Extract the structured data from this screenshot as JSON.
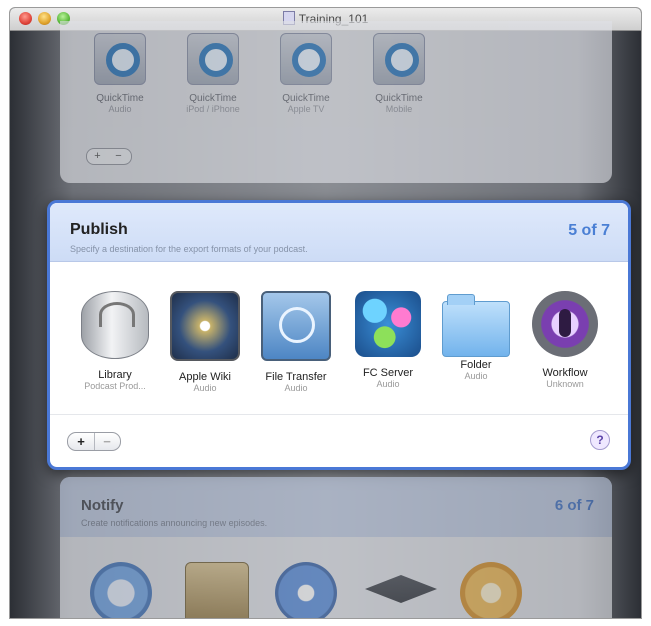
{
  "window": {
    "title": "Training_101"
  },
  "top_card": {
    "items": [
      {
        "label": "QuickTime",
        "sub": "Audio"
      },
      {
        "label": "QuickTime",
        "sub": "iPod / iPhone"
      },
      {
        "label": "QuickTime",
        "sub": "Apple TV"
      },
      {
        "label": "QuickTime",
        "sub": "Mobile"
      }
    ],
    "add": "+",
    "remove": "−"
  },
  "publish": {
    "title": "Publish",
    "subtitle": "Specify a destination for the export formats of your podcast.",
    "count": "5 of 7",
    "targets": [
      {
        "label": "Library",
        "sub": "Podcast Prod..."
      },
      {
        "label": "Apple Wiki",
        "sub": "Audio"
      },
      {
        "label": "File Transfer",
        "sub": "Audio"
      },
      {
        "label": "FC Server",
        "sub": "Audio"
      },
      {
        "label": "Folder",
        "sub": "Audio"
      },
      {
        "label": "Workflow",
        "sub": "Unknown"
      }
    ],
    "add": "+",
    "remove": "−",
    "help": "?"
  },
  "notify": {
    "title": "Notify",
    "subtitle": "Create notifications announcing new episodes.",
    "count": "6 of 7"
  }
}
